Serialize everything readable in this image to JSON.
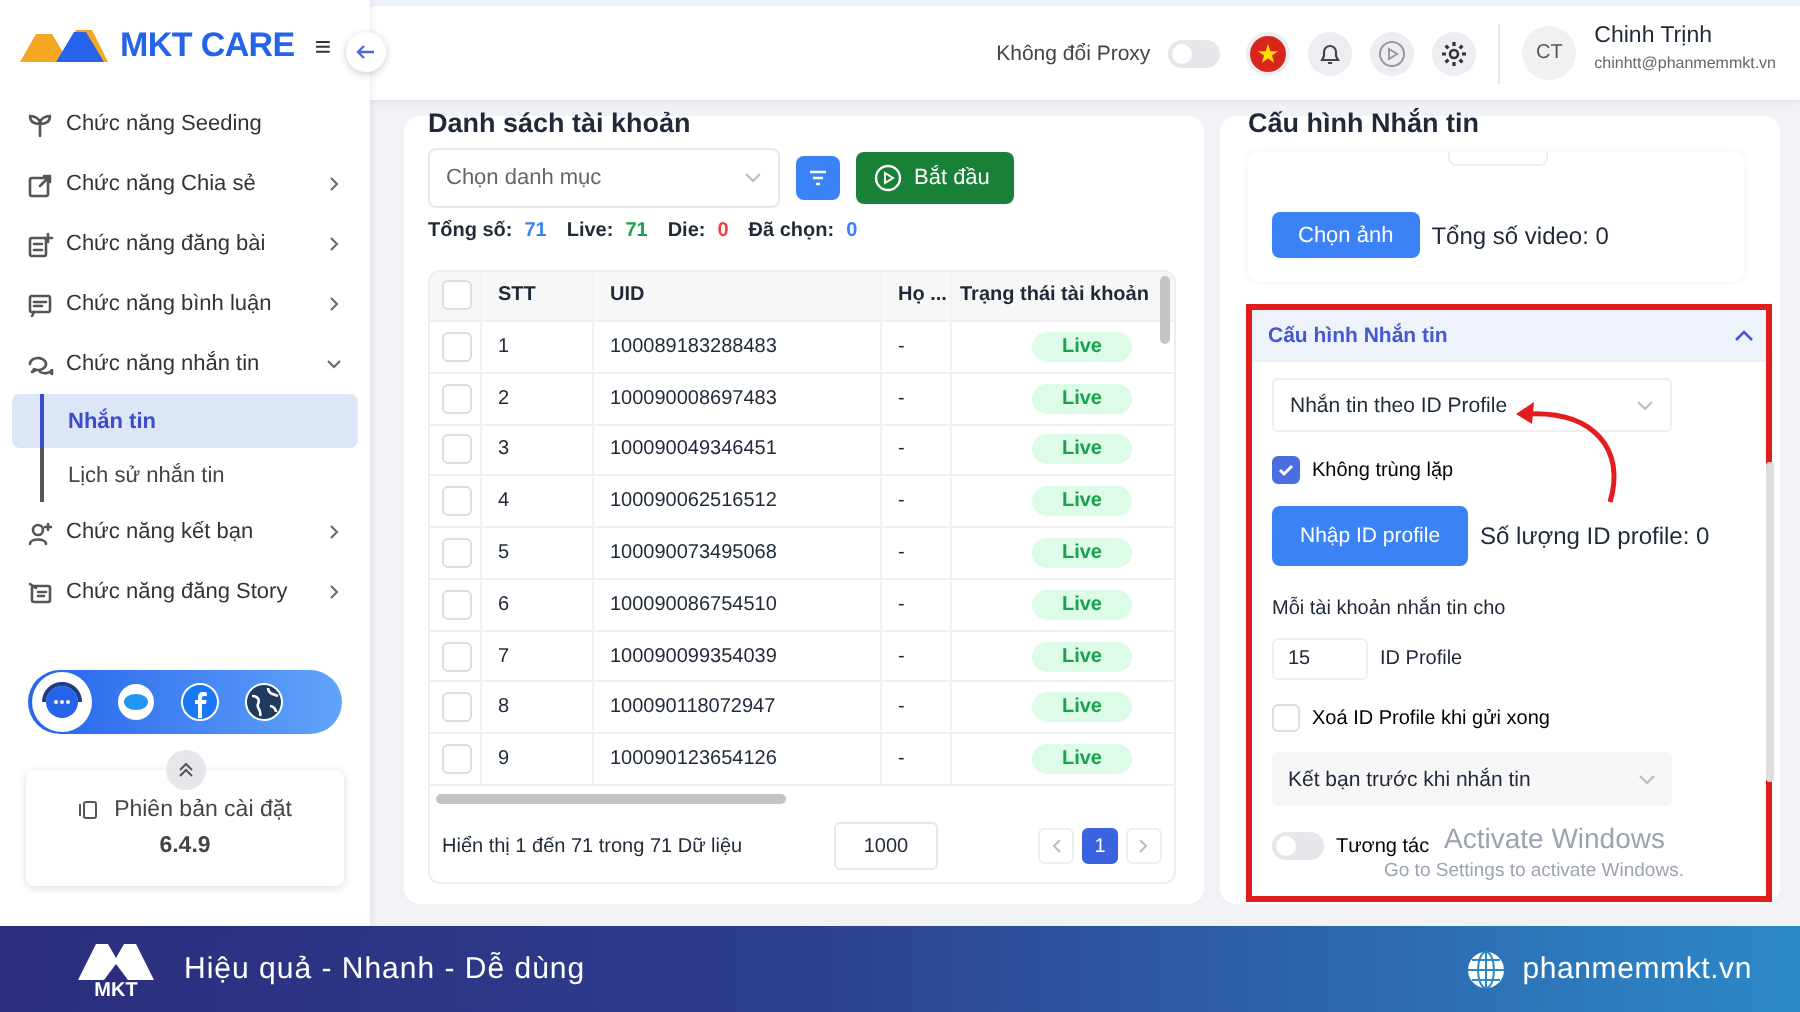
{
  "app": {
    "logo_text": "MKT CARE",
    "menu_icon": "≡"
  },
  "sidebar": {
    "items": [
      {
        "label": "Chức năng Seeding",
        "kind": "link"
      },
      {
        "label": "Chức năng Chia sẻ",
        "kind": "group",
        "expanded": false
      },
      {
        "label": "Chức năng đăng bài",
        "kind": "group",
        "expanded": false
      },
      {
        "label": "Chức năng bình luận",
        "kind": "group",
        "expanded": false
      },
      {
        "label": "Chức năng nhắn tin",
        "kind": "group",
        "expanded": true,
        "children": [
          {
            "label": "Nhắn tin",
            "selected": true
          },
          {
            "label": "Lịch sử nhắn tin",
            "selected": false
          }
        ]
      },
      {
        "label": "Chức năng kết bạn",
        "kind": "group",
        "expanded": false
      },
      {
        "label": "Chức năng đăng Story",
        "kind": "group",
        "expanded": false
      }
    ],
    "version_label": "Phiên bản cài đặt",
    "version": "6.4.9"
  },
  "header": {
    "proxy": {
      "label": "Không đổi Proxy",
      "on": false
    },
    "user": {
      "initials": "CT",
      "name": "Chinh Trịnh",
      "email": "chinhtt@phanmemmkt.vn"
    }
  },
  "accounts": {
    "title": "Danh sách tài khoản",
    "category": {
      "placeholder": "Chọn danh mục"
    },
    "start_button": "Bắt đầu",
    "stats": [
      {
        "label": "Tổng số:",
        "value": "71",
        "color": "#3b82f6"
      },
      {
        "label": "Live:",
        "value": "71",
        "color": "#16a34a"
      },
      {
        "label": "Die:",
        "value": "0",
        "color": "#ef4444"
      },
      {
        "label": "Đã chọn:",
        "value": "0",
        "color": "#3b82f6"
      }
    ],
    "table": {
      "all_checked": false,
      "columns": [
        "STT",
        "UID",
        "Họ ...",
        "Trạng thái tài khoản"
      ],
      "rows": [
        {
          "stt": "1",
          "uid": "100089183288483",
          "name": "-",
          "status": "Live",
          "checked": false
        },
        {
          "stt": "2",
          "uid": "100090008697483",
          "name": "-",
          "status": "Live",
          "checked": false
        },
        {
          "stt": "3",
          "uid": "100090049346451",
          "name": "-",
          "status": "Live",
          "checked": false
        },
        {
          "stt": "4",
          "uid": "100090062516512",
          "name": "-",
          "status": "Live",
          "checked": false
        },
        {
          "stt": "5",
          "uid": "100090073495068",
          "name": "-",
          "status": "Live",
          "checked": false
        },
        {
          "stt": "6",
          "uid": "100090086754510",
          "name": "-",
          "status": "Live",
          "checked": false
        },
        {
          "stt": "7",
          "uid": "100090099354039",
          "name": "-",
          "status": "Live",
          "checked": false
        },
        {
          "stt": "8",
          "uid": "100090118072947",
          "name": "-",
          "status": "Live",
          "checked": false
        },
        {
          "stt": "9",
          "uid": "100090123654126",
          "name": "-",
          "status": "Live",
          "checked": false
        }
      ]
    },
    "summary": "Hiển thị 1 đến 71 trong 71 Dữ liệu",
    "page_size": "1000",
    "pages": [
      {
        "label": "1",
        "selected": true
      }
    ]
  },
  "config": {
    "title": "Cấu hình Nhắn tin",
    "upload_button": "Chọn ảnh",
    "video_count": "Tổng số video: 0",
    "section": {
      "title": "Cấu hình Nhắn tin",
      "expanded": true,
      "mode": "Nhắn tin theo ID Profile",
      "no_duplicate": {
        "label": "Không trùng lặp",
        "checked": true
      },
      "import_button": "Nhập ID profile",
      "id_count": "Số lượng ID profile: 0",
      "per_account_label": "Mỗi tài khoản nhắn tin cho",
      "per_account_value": "15",
      "per_account_unit": "ID Profile",
      "delete_after": {
        "label": "Xoá ID Profile khi gửi xong",
        "checked": false
      },
      "friend_mode": "Kết bạn trước khi nhắn tin",
      "interact": {
        "label": "Tương tác",
        "on": false
      }
    }
  },
  "os_watermark": [
    "Activate Windows",
    "Go to Settings to activate Windows."
  ],
  "banner": {
    "logo_text": "MKT",
    "slogan": "Hiệu quả - Nhanh - Dễ dùng",
    "site": "phanmemmkt.vn"
  }
}
